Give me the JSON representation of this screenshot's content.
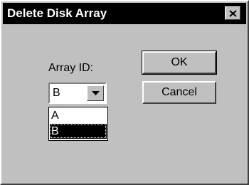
{
  "dialog": {
    "title": "Delete Disk Array",
    "close_icon": "close-icon"
  },
  "form": {
    "array_id_label": "Array ID:",
    "selected_value": "B",
    "options": [
      "A",
      "B"
    ],
    "highlighted_option": "B"
  },
  "buttons": {
    "ok_label": "OK",
    "cancel_label": "Cancel"
  },
  "colors": {
    "title_bar": "#000000",
    "title_text": "#ffffff",
    "face": "#c0c0c0",
    "highlight": "#000000"
  }
}
